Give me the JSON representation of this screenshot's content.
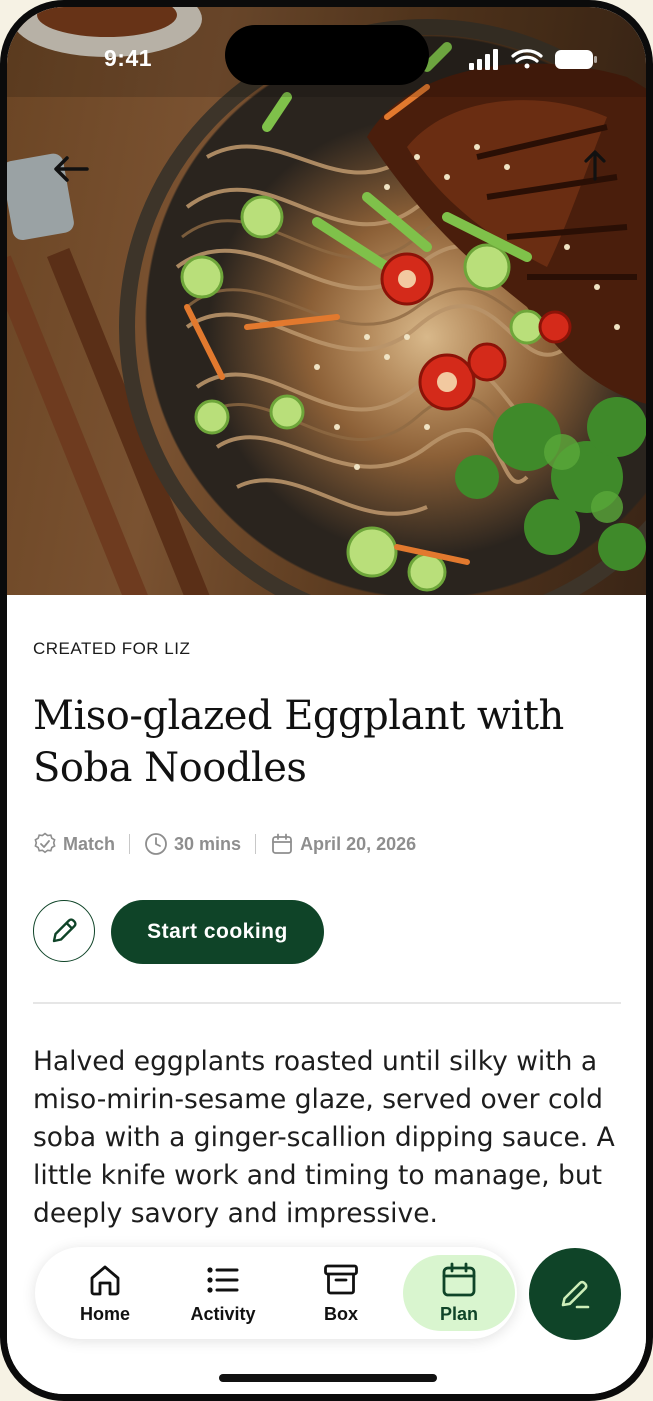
{
  "status_bar": {
    "time": "9:41"
  },
  "recipe": {
    "created_for": "CREATED FOR LIZ",
    "title": "Miso-glazed Eggplant with Soba Noodles",
    "meta": [
      {
        "icon": "check-badge-icon",
        "label": "Match"
      },
      {
        "icon": "clock-icon",
        "label": "30 mins"
      },
      {
        "icon": "calendar-icon",
        "label": "April 20, 2026"
      }
    ],
    "start_label": "Start cooking",
    "description": "Halved eggplants roasted until silky with a miso-mirin-sesame glaze, served over cold soba with a ginger-scallion dipping sauce. A little knife work and timing to manage, but deeply savory and impressive."
  },
  "nav": {
    "items": [
      {
        "label": "Home",
        "icon": "home-icon"
      },
      {
        "label": "Activity",
        "icon": "list-icon"
      },
      {
        "label": "Box",
        "icon": "box-icon"
      },
      {
        "label": "Plan",
        "icon": "calendar-icon",
        "active": true
      }
    ]
  },
  "colors": {
    "brand_green": "#0f4428",
    "active_tab": "#d9f5cf",
    "meta_gray": "#8e8e8e"
  }
}
